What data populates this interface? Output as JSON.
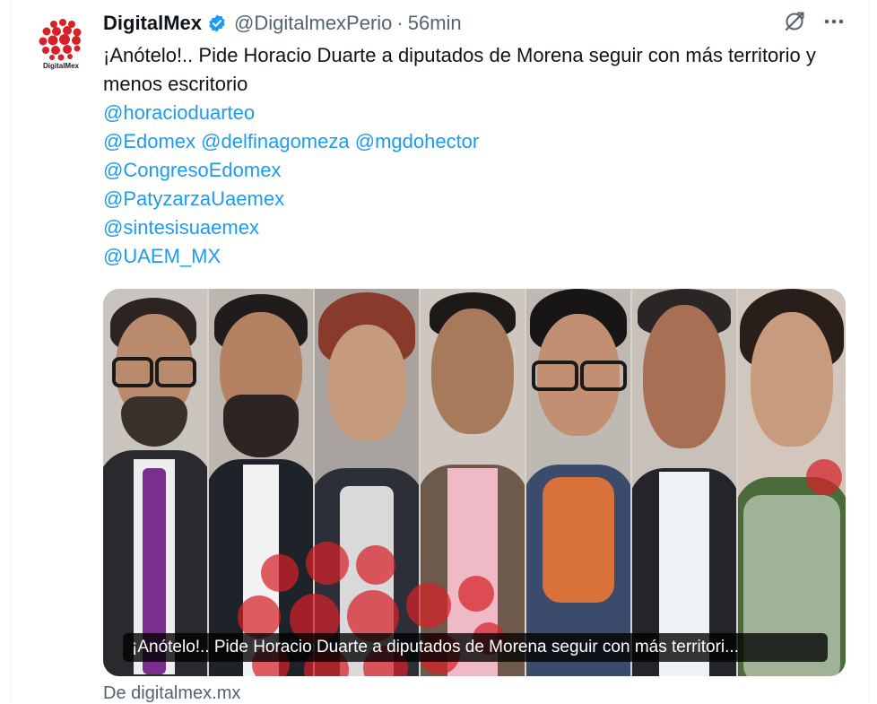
{
  "author": {
    "name": "DigitalMex",
    "handle": "@DigitalmexPerio",
    "separator": "·",
    "time": "56min",
    "avatar_text": "DigitalMex"
  },
  "colors": {
    "link": "#1d9bf0",
    "muted": "#536471",
    "verified": "#1d9bf0",
    "brand_red": "#d62128"
  },
  "icons": {
    "verified": "verified-badge-icon",
    "grok": "grok-icon",
    "more": "more-options-icon"
  },
  "tweet": {
    "text": "¡Anótelo!.. Pide Horacio Duarte a diputados de Morena seguir con más territorio y menos escritorio",
    "mention_lines": [
      [
        "@horacioduarteo"
      ],
      [
        "@Edomex",
        "@delfinagomeza",
        "@mgdohector"
      ],
      [
        "@CongresoEdomex"
      ],
      [
        "@PatyzarzaUaemex"
      ],
      [
        "@sintesisuaemex"
      ],
      [
        "@UAEM_MX"
      ]
    ]
  },
  "card": {
    "title": "¡Anótelo!.. Pide Horacio Duarte a diputados de Morena seguir con más territori...",
    "source": "De digitalmex.mx"
  }
}
